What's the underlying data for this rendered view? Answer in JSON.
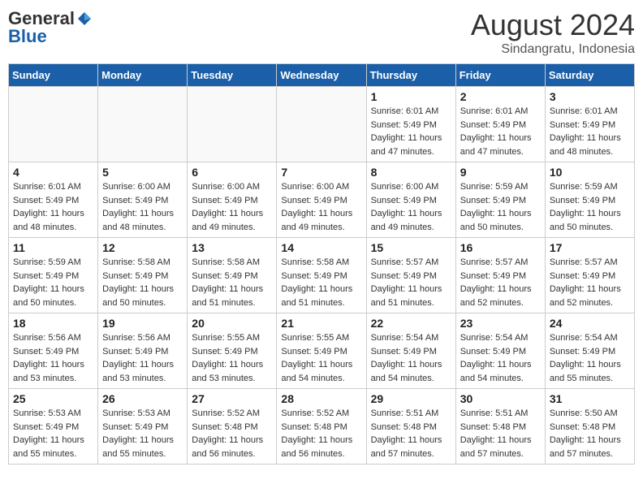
{
  "header": {
    "logo_general": "General",
    "logo_blue": "Blue",
    "month_title": "August 2024",
    "location": "Sindangratu, Indonesia"
  },
  "weekdays": [
    "Sunday",
    "Monday",
    "Tuesday",
    "Wednesday",
    "Thursday",
    "Friday",
    "Saturday"
  ],
  "weeks": [
    [
      {
        "day": "",
        "sunrise": "",
        "sunset": "",
        "daylight": ""
      },
      {
        "day": "",
        "sunrise": "",
        "sunset": "",
        "daylight": ""
      },
      {
        "day": "",
        "sunrise": "",
        "sunset": "",
        "daylight": ""
      },
      {
        "day": "",
        "sunrise": "",
        "sunset": "",
        "daylight": ""
      },
      {
        "day": "1",
        "sunrise": "Sunrise: 6:01 AM",
        "sunset": "Sunset: 5:49 PM",
        "daylight": "Daylight: 11 hours and 47 minutes."
      },
      {
        "day": "2",
        "sunrise": "Sunrise: 6:01 AM",
        "sunset": "Sunset: 5:49 PM",
        "daylight": "Daylight: 11 hours and 47 minutes."
      },
      {
        "day": "3",
        "sunrise": "Sunrise: 6:01 AM",
        "sunset": "Sunset: 5:49 PM",
        "daylight": "Daylight: 11 hours and 48 minutes."
      }
    ],
    [
      {
        "day": "4",
        "sunrise": "Sunrise: 6:01 AM",
        "sunset": "Sunset: 5:49 PM",
        "daylight": "Daylight: 11 hours and 48 minutes."
      },
      {
        "day": "5",
        "sunrise": "Sunrise: 6:00 AM",
        "sunset": "Sunset: 5:49 PM",
        "daylight": "Daylight: 11 hours and 48 minutes."
      },
      {
        "day": "6",
        "sunrise": "Sunrise: 6:00 AM",
        "sunset": "Sunset: 5:49 PM",
        "daylight": "Daylight: 11 hours and 49 minutes."
      },
      {
        "day": "7",
        "sunrise": "Sunrise: 6:00 AM",
        "sunset": "Sunset: 5:49 PM",
        "daylight": "Daylight: 11 hours and 49 minutes."
      },
      {
        "day": "8",
        "sunrise": "Sunrise: 6:00 AM",
        "sunset": "Sunset: 5:49 PM",
        "daylight": "Daylight: 11 hours and 49 minutes."
      },
      {
        "day": "9",
        "sunrise": "Sunrise: 5:59 AM",
        "sunset": "Sunset: 5:49 PM",
        "daylight": "Daylight: 11 hours and 50 minutes."
      },
      {
        "day": "10",
        "sunrise": "Sunrise: 5:59 AM",
        "sunset": "Sunset: 5:49 PM",
        "daylight": "Daylight: 11 hours and 50 minutes."
      }
    ],
    [
      {
        "day": "11",
        "sunrise": "Sunrise: 5:59 AM",
        "sunset": "Sunset: 5:49 PM",
        "daylight": "Daylight: 11 hours and 50 minutes."
      },
      {
        "day": "12",
        "sunrise": "Sunrise: 5:58 AM",
        "sunset": "Sunset: 5:49 PM",
        "daylight": "Daylight: 11 hours and 50 minutes."
      },
      {
        "day": "13",
        "sunrise": "Sunrise: 5:58 AM",
        "sunset": "Sunset: 5:49 PM",
        "daylight": "Daylight: 11 hours and 51 minutes."
      },
      {
        "day": "14",
        "sunrise": "Sunrise: 5:58 AM",
        "sunset": "Sunset: 5:49 PM",
        "daylight": "Daylight: 11 hours and 51 minutes."
      },
      {
        "day": "15",
        "sunrise": "Sunrise: 5:57 AM",
        "sunset": "Sunset: 5:49 PM",
        "daylight": "Daylight: 11 hours and 51 minutes."
      },
      {
        "day": "16",
        "sunrise": "Sunrise: 5:57 AM",
        "sunset": "Sunset: 5:49 PM",
        "daylight": "Daylight: 11 hours and 52 minutes."
      },
      {
        "day": "17",
        "sunrise": "Sunrise: 5:57 AM",
        "sunset": "Sunset: 5:49 PM",
        "daylight": "Daylight: 11 hours and 52 minutes."
      }
    ],
    [
      {
        "day": "18",
        "sunrise": "Sunrise: 5:56 AM",
        "sunset": "Sunset: 5:49 PM",
        "daylight": "Daylight: 11 hours and 53 minutes."
      },
      {
        "day": "19",
        "sunrise": "Sunrise: 5:56 AM",
        "sunset": "Sunset: 5:49 PM",
        "daylight": "Daylight: 11 hours and 53 minutes."
      },
      {
        "day": "20",
        "sunrise": "Sunrise: 5:55 AM",
        "sunset": "Sunset: 5:49 PM",
        "daylight": "Daylight: 11 hours and 53 minutes."
      },
      {
        "day": "21",
        "sunrise": "Sunrise: 5:55 AM",
        "sunset": "Sunset: 5:49 PM",
        "daylight": "Daylight: 11 hours and 54 minutes."
      },
      {
        "day": "22",
        "sunrise": "Sunrise: 5:54 AM",
        "sunset": "Sunset: 5:49 PM",
        "daylight": "Daylight: 11 hours and 54 minutes."
      },
      {
        "day": "23",
        "sunrise": "Sunrise: 5:54 AM",
        "sunset": "Sunset: 5:49 PM",
        "daylight": "Daylight: 11 hours and 54 minutes."
      },
      {
        "day": "24",
        "sunrise": "Sunrise: 5:54 AM",
        "sunset": "Sunset: 5:49 PM",
        "daylight": "Daylight: 11 hours and 55 minutes."
      }
    ],
    [
      {
        "day": "25",
        "sunrise": "Sunrise: 5:53 AM",
        "sunset": "Sunset: 5:49 PM",
        "daylight": "Daylight: 11 hours and 55 minutes."
      },
      {
        "day": "26",
        "sunrise": "Sunrise: 5:53 AM",
        "sunset": "Sunset: 5:49 PM",
        "daylight": "Daylight: 11 hours and 55 minutes."
      },
      {
        "day": "27",
        "sunrise": "Sunrise: 5:52 AM",
        "sunset": "Sunset: 5:48 PM",
        "daylight": "Daylight: 11 hours and 56 minutes."
      },
      {
        "day": "28",
        "sunrise": "Sunrise: 5:52 AM",
        "sunset": "Sunset: 5:48 PM",
        "daylight": "Daylight: 11 hours and 56 minutes."
      },
      {
        "day": "29",
        "sunrise": "Sunrise: 5:51 AM",
        "sunset": "Sunset: 5:48 PM",
        "daylight": "Daylight: 11 hours and 57 minutes."
      },
      {
        "day": "30",
        "sunrise": "Sunrise: 5:51 AM",
        "sunset": "Sunset: 5:48 PM",
        "daylight": "Daylight: 11 hours and 57 minutes."
      },
      {
        "day": "31",
        "sunrise": "Sunrise: 5:50 AM",
        "sunset": "Sunset: 5:48 PM",
        "daylight": "Daylight: 11 hours and 57 minutes."
      }
    ]
  ]
}
